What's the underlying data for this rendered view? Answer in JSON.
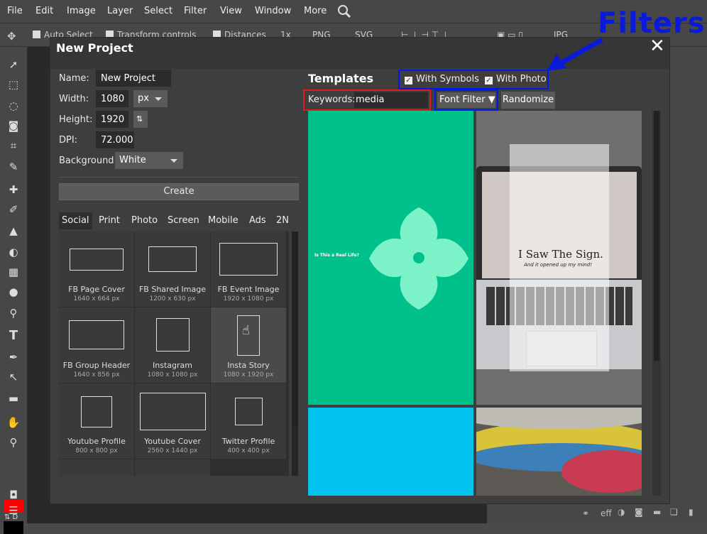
{
  "menubar": {
    "items": [
      "File",
      "Edit",
      "Image",
      "Layer",
      "Select",
      "Filter",
      "View",
      "Window",
      "More"
    ]
  },
  "optionsbar": {
    "auto_select": "Auto Select",
    "transform_controls": "Transform controls",
    "distances": "Distances",
    "zoom": "1x",
    "png": "PNG",
    "svg": "SVG",
    "size_label": "JPG"
  },
  "dialog": {
    "title": "New Project",
    "name_label": "Name:",
    "name_value": "New Project",
    "width_label": "Width:",
    "width_value": "1080",
    "unit_value": "px",
    "height_label": "Height:",
    "height_value": "1920",
    "dpi_label": "DPI:",
    "dpi_value": "72.000",
    "background_label": "Background:",
    "background_value": "White",
    "create_label": "Create",
    "tabs": [
      "Social",
      "Print",
      "Photo",
      "Screen",
      "Mobile",
      "Ads",
      "2N"
    ],
    "presets": [
      {
        "name": "FB Page Cover",
        "size": "1640 x 664 px"
      },
      {
        "name": "FB Shared Image",
        "size": "1200 x 630 px"
      },
      {
        "name": "FB Event Image",
        "size": "1920 x 1080 px"
      },
      {
        "name": "FB Group Header",
        "size": "1640 x 856 px"
      },
      {
        "name": "Instagram",
        "size": "1080 x 1080 px"
      },
      {
        "name": "Insta Story",
        "size": "1080 x 1920 px"
      },
      {
        "name": "Youtube Profile",
        "size": "800 x 800 px"
      },
      {
        "name": "Youtube Cover",
        "size": "2560 x 1440 px"
      },
      {
        "name": "Twitter Profile",
        "size": "400 x 400 px"
      }
    ],
    "templates_title": "Templates",
    "with_symbols": "With Symbols",
    "with_photo": "With Photo",
    "keywords_label": "Keywords:",
    "keywords_value": "media",
    "font_filter": "Font Filter",
    "randomize": "Randomize",
    "tpl1_text": "Is This a Real Life?",
    "tpl2_title": "I Saw The Sign.",
    "tpl2_sub": "And it opened up my mind!"
  },
  "annotation": {
    "callout": "Filters"
  },
  "bottombar": {
    "eff": "eff"
  },
  "colors": {
    "accent_red": "#e01a1a",
    "accent_blue": "#0018e8",
    "teal": "#00c08c",
    "cyan": "#00c4ee"
  }
}
